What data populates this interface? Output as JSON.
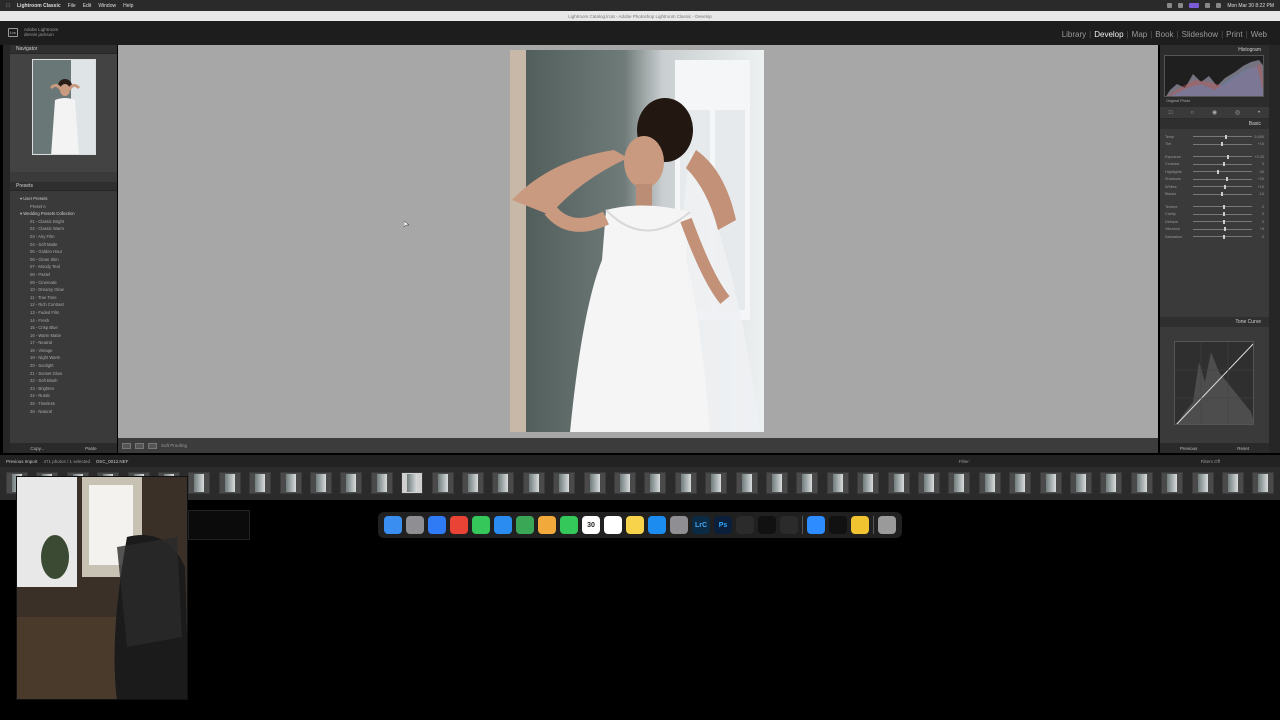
{
  "menubar": {
    "app_name": "Lightroom Classic",
    "items": [
      "File",
      "Edit",
      "Window",
      "Help"
    ],
    "datetime": "Mon Mar 30 8:22 PM"
  },
  "titlebar": {
    "title": "Lightroom Catalog.lrcat - Adobe Photoshop Lightroom Classic - Develop"
  },
  "header": {
    "logo": "Lrc",
    "identity_line1": "Adobe Lightroom",
    "identity_line2": "dennis jackson",
    "modules": [
      "Library",
      "Develop",
      "Map",
      "Book",
      "Slideshow",
      "Print",
      "Web"
    ],
    "active_module": "Develop"
  },
  "left_panel": {
    "navigator_label": "Navigator",
    "presets_label": "Presets",
    "groups": [
      {
        "name": "User Presets",
        "items": [
          "Preset A"
        ]
      },
      {
        "name": "Wedding Presets Collection",
        "items": [
          "01 - Classic Bright",
          "02 - Classic Warm",
          "03 - Airy Film",
          "04 - Soft Matte",
          "05 - Golden Hour",
          "06 - Clean Skin",
          "07 - Moody Teal",
          "08 - Pastel",
          "09 - Cinematic",
          "10 - Dreamy Glow",
          "11 - True Tone",
          "12 - Rich Contrast",
          "13 - Faded Film",
          "14 - Fresh",
          "15 - Crisp Blue",
          "16 - Warm Matte",
          "17 - Neutral",
          "18 - Vintage",
          "19 - Night Warm",
          "20 - Sunlight",
          "21 - Sunset Glow",
          "22 - Soft Blush",
          "23 - Brighten",
          "24 - Rustic",
          "25 - Timeless",
          "26 - Natural"
        ]
      }
    ],
    "copy_label": "Copy...",
    "paste_label": "Paste"
  },
  "toolbar": {
    "soft_proofing": "Soft Proofing"
  },
  "right_panel": {
    "histogram_label": "Histogram",
    "original_photo": "Original Photo",
    "basic_label": "Basic",
    "tone_curve_label": "Tone Curve",
    "previous_label": "Previous",
    "reset_label": "Reset",
    "sliders": [
      {
        "label": "Temp",
        "value": "5,400"
      },
      {
        "label": "Tint",
        "value": "+10"
      },
      {
        "label": "Exposure",
        "value": "+0.30"
      },
      {
        "label": "Contrast",
        "value": "0"
      },
      {
        "label": "Highlights",
        "value": "-40"
      },
      {
        "label": "Shadows",
        "value": "+20"
      },
      {
        "label": "Whites",
        "value": "+10"
      },
      {
        "label": "Blacks",
        "value": "-10"
      },
      {
        "label": "Texture",
        "value": "0"
      },
      {
        "label": "Clarity",
        "value": "0"
      },
      {
        "label": "Dehaze",
        "value": "0"
      },
      {
        "label": "Vibrance",
        "value": "+5"
      },
      {
        "label": "Saturation",
        "value": "0"
      }
    ]
  },
  "filmstrip": {
    "breadcrumb": "Previous Import",
    "count": "471 photos / 1 selected",
    "filename": "DSC_0012.NEF",
    "filter_label": "Filter:",
    "filter_value": "Filters Off"
  },
  "dock": {
    "icons": [
      "finder-icon",
      "launchpad-icon",
      "safari-icon",
      "chrome-icon",
      "messages-icon",
      "mail-icon",
      "maps-icon",
      "photos-icon",
      "facetime-icon",
      "calendar-icon",
      "reminders-icon",
      "notes-icon",
      "appstore-icon",
      "settings-icon",
      "lightroom-icon",
      "photoshop-icon",
      "davinci-icon",
      "capcut-icon",
      "screenshot-icon",
      "zoom-icon",
      "chatgpt-icon",
      "preview-icon",
      "trash-icon"
    ],
    "calendar_day": "30",
    "lrc_label": "LrC",
    "ps_label": "Ps"
  }
}
